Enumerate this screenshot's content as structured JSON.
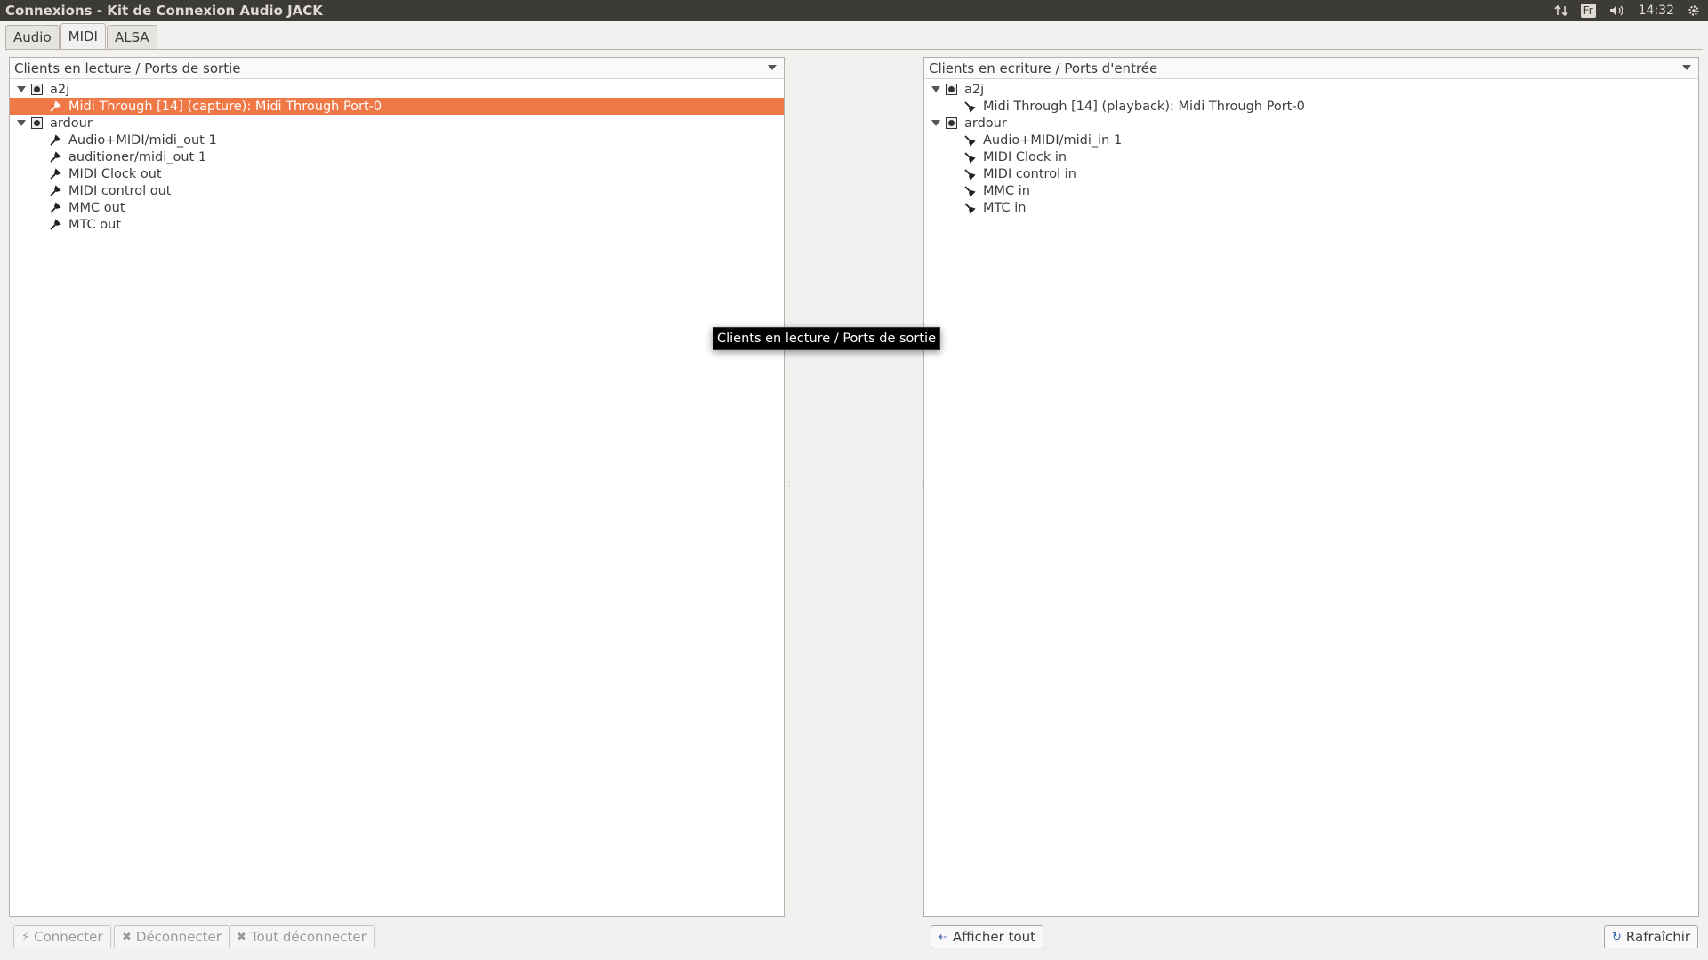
{
  "window": {
    "title": "Connexions - Kit de Connexion Audio JACK"
  },
  "tray": {
    "keyboard_layout": "Fr",
    "time": "14:32"
  },
  "tabs": [
    {
      "label": "Audio",
      "active": false
    },
    {
      "label": "MIDI",
      "active": true
    },
    {
      "label": "ALSA",
      "active": false
    }
  ],
  "left_panel": {
    "header": "Clients en lecture / Ports de sortie",
    "clients": [
      {
        "name": "a2j",
        "ports": [
          "Midi Through [14] (capture): Midi Through Port-0"
        ],
        "selected_port": 0
      },
      {
        "name": "ardour",
        "ports": [
          "Audio+MIDI/midi_out 1",
          "auditioner/midi_out 1",
          "MIDI Clock out",
          "MIDI control out",
          "MMC out",
          "MTC out"
        ]
      }
    ]
  },
  "right_panel": {
    "header": "Clients en ecriture / Ports d'entrée",
    "clients": [
      {
        "name": "a2j",
        "ports": [
          "Midi Through [14] (playback): Midi Through Port-0"
        ]
      },
      {
        "name": "ardour",
        "ports": [
          "Audio+MIDI/midi_in 1",
          "MIDI Clock in",
          "MIDI control in",
          "MMC in",
          "MTC in"
        ]
      }
    ]
  },
  "tooltip": "Clients en lecture / Ports de sortie",
  "buttons": {
    "connect": "Connecter",
    "disconnect": "Déconnecter",
    "disconnect_all": "Tout déconnecter",
    "show_all": "Afficher tout",
    "refresh": "Rafraîchir"
  },
  "colors": {
    "selection": "#f07746",
    "titlebar": "#3c3b37"
  }
}
